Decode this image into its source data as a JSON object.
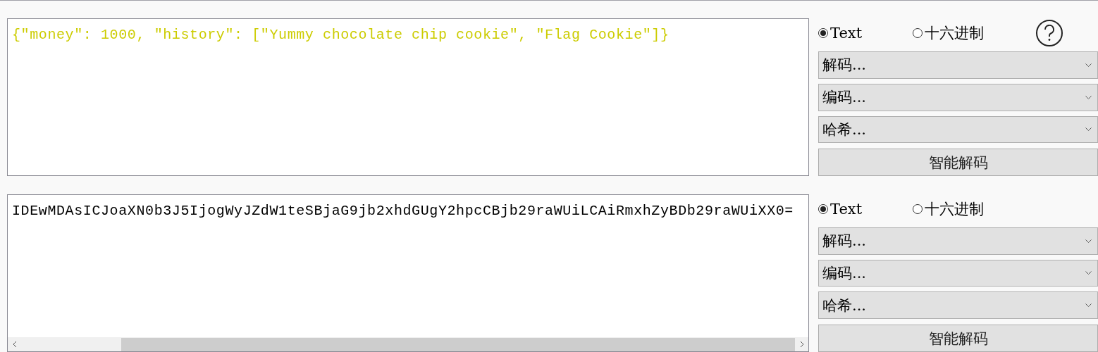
{
  "panels": [
    {
      "text": "{\"money\": 1000, \"history\": [\"Yummy chocolate chip cookie\", \"Flag Cookie\"]}",
      "color": "#cccc00",
      "scrollbar": false,
      "help": true,
      "options": [
        {
          "label": "Text",
          "selected": true
        },
        {
          "label": "十六进制",
          "selected": false
        }
      ],
      "dropdowns": [
        "解码...",
        "编码...",
        "哈希..."
      ],
      "button": "智能解码"
    },
    {
      "text": "IDEwMDAsICJoaXN0b3J5IjogWyJZdW1teSBjaG9jb2xhdGUgY2hpcCBjb29raWUiLCAiRmxhZyBDb29raWUiXX0=",
      "color": "#000000",
      "scrollbar": true,
      "help": false,
      "options": [
        {
          "label": "Text",
          "selected": true
        },
        {
          "label": "十六进制",
          "selected": false
        }
      ],
      "dropdowns": [
        "解码...",
        "编码...",
        "哈希..."
      ],
      "button": "智能解码"
    }
  ]
}
